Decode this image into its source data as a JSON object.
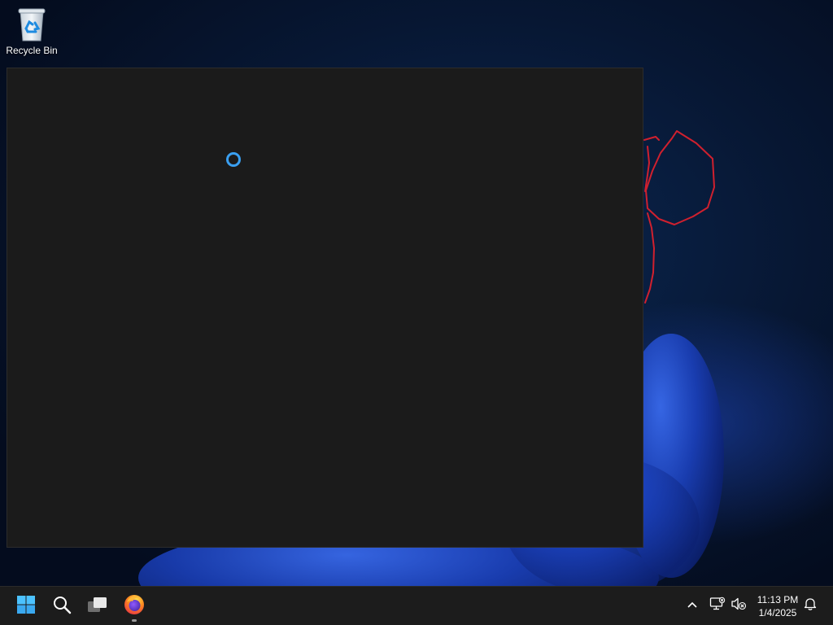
{
  "desktop": {
    "icons": [
      {
        "label": "Recycle Bin",
        "icon": "recycle-bin-icon"
      }
    ]
  },
  "window": {
    "state": "loading",
    "spinner_icon": "loading-spinner-icon",
    "background_color": "#1b1b1b",
    "spinner_color": "#3a9ff0"
  },
  "annotation": {
    "color": "#d0202e"
  },
  "taskbar": {
    "apps": [
      {
        "name": "Start",
        "icon": "windows-start-icon"
      },
      {
        "name": "Search",
        "icon": "search-icon"
      },
      {
        "name": "Task View",
        "icon": "task-view-icon"
      },
      {
        "name": "Firefox",
        "icon": "firefox-icon",
        "running": true
      }
    ],
    "tray": {
      "overflow_icon": "chevron-up-icon",
      "network_icon": "network-disconnected-icon",
      "volume_icon": "volume-muted-icon",
      "notification_icon": "bell-icon"
    },
    "clock": {
      "time": "11:13 PM",
      "date": "1/4/2025"
    }
  }
}
